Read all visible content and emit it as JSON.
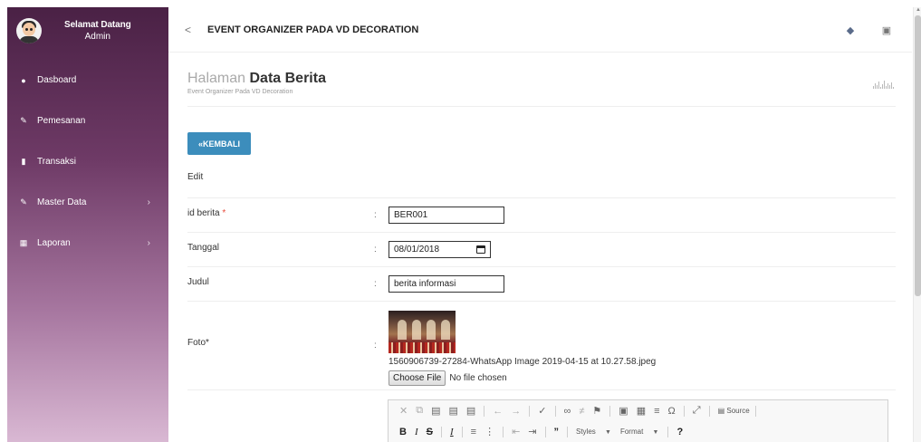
{
  "sidebar": {
    "greeting": "Selamat Datang",
    "role": "Admin",
    "items": [
      {
        "label": "Dasboard",
        "icon": "dashboard-icon",
        "has_sub": false
      },
      {
        "label": "Pemesanan",
        "icon": "pencil-icon",
        "has_sub": false
      },
      {
        "label": "Transaksi",
        "icon": "book-icon",
        "has_sub": false
      },
      {
        "label": "Master Data",
        "icon": "edit-icon",
        "has_sub": true
      },
      {
        "label": "Laporan",
        "icon": "calendar-icon",
        "has_sub": true
      }
    ]
  },
  "header": {
    "back_glyph": "<",
    "title": "EVENT ORGANIZER PADA VD DECORATION"
  },
  "page": {
    "title_light": "Halaman",
    "title_bold": "Data Berita",
    "subtitle": "Event Organizer Pada VD Decoration"
  },
  "actions": {
    "back_label": "KEMBALI",
    "back_glyph": "«",
    "edit_label": "Edit"
  },
  "form": {
    "id_label": "id berita",
    "id_required_mark": "*",
    "id_value": "BER001",
    "date_label": "Tanggal",
    "date_value": "08/01/2018",
    "title_label": "Judul",
    "title_value": "berita informasi",
    "photo_label": "Foto*",
    "photo_filename": "1560906739-27284-WhatsApp Image 2019-04-15 at 10.27.58.jpeg",
    "choose_file_label": "Choose File",
    "no_file_label": "No file chosen",
    "colon": ":"
  },
  "editor": {
    "source_label": "Source",
    "styles_label": "Styles",
    "format_label": "Format",
    "help_label": "?"
  },
  "colors": {
    "primary": "#3c8dbc",
    "sidebar_top": "#4a2145",
    "sidebar_bottom": "#d9b8d3",
    "required": "#e74c3c"
  }
}
